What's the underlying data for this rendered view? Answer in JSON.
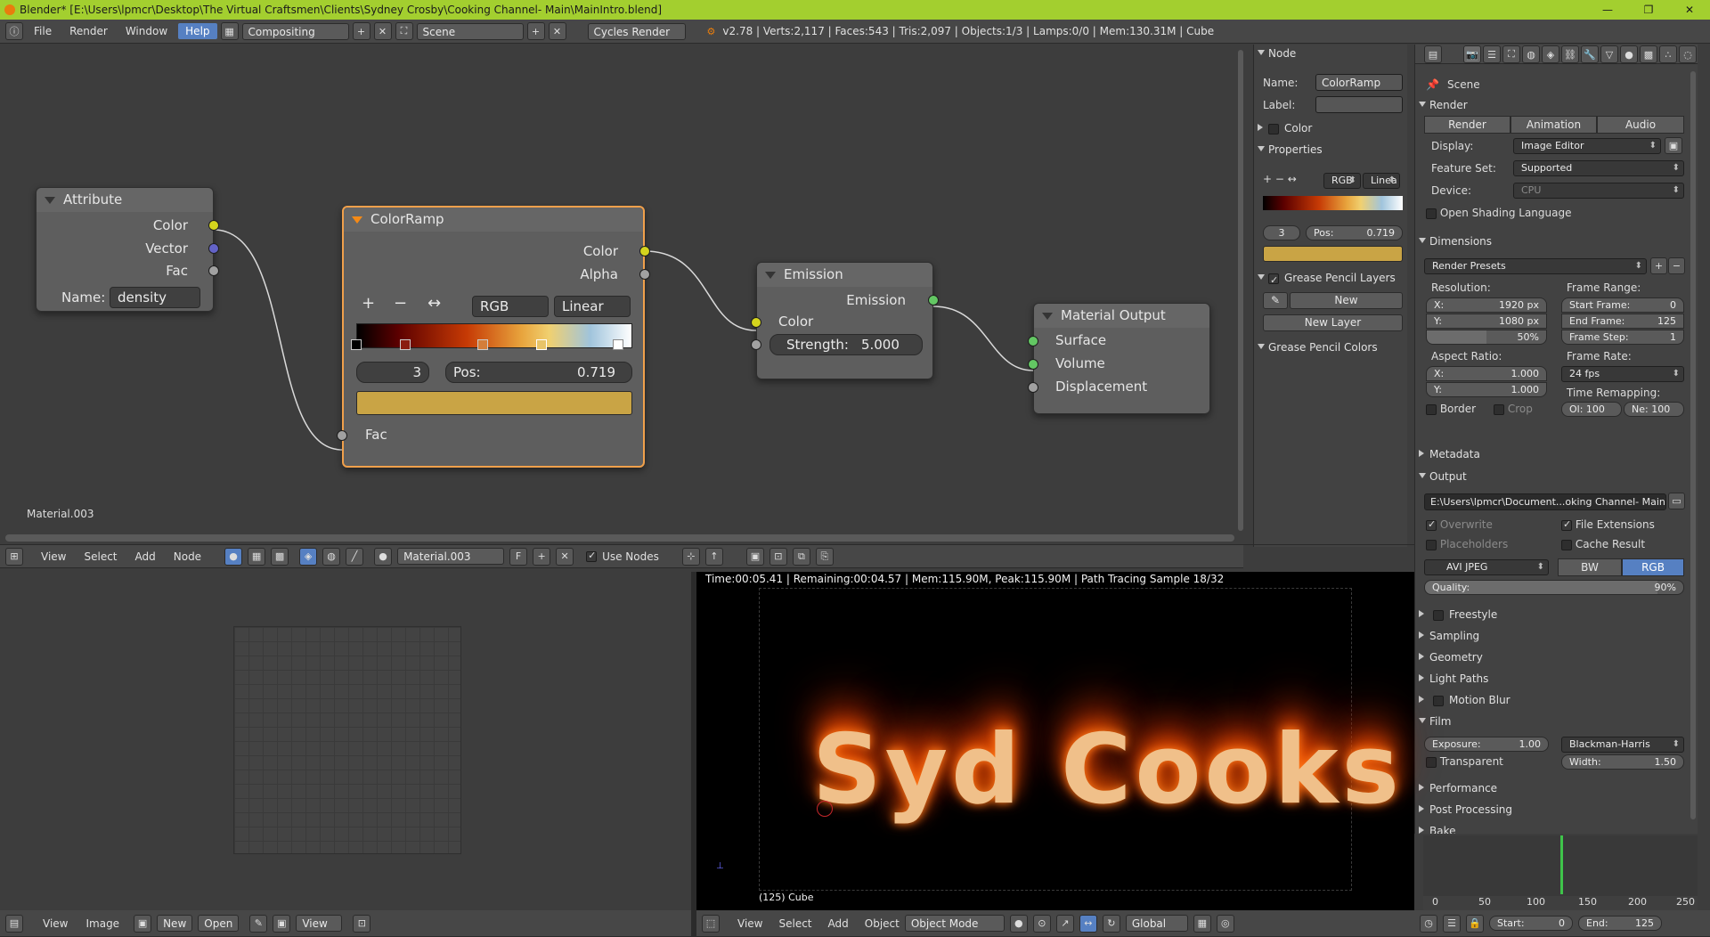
{
  "window": {
    "title": "Blender* [E:\\Users\\lpmcr\\Desktop\\The Virtual Craftsmen\\Clients\\Sydney Crosby\\Cooking Channel- Main\\MainIntro.blend]",
    "controls": [
      "—",
      "❐",
      "✕"
    ]
  },
  "menubar": {
    "items": [
      "File",
      "Render",
      "Window",
      "Help"
    ],
    "active": "Help",
    "screen": "Compositing",
    "scene": "Scene",
    "engine": "Cycles Render",
    "info": "v2.78 | Verts:2,117 | Faces:543 | Tris:2,097 | Objects:1/3 | Lamps:0/0 | Mem:130.31M | Cube"
  },
  "nodes": {
    "attribute": {
      "title": "Attribute",
      "outputs": [
        "Color",
        "Vector",
        "Fac"
      ],
      "name_label": "Name:",
      "name_value": "density"
    },
    "colorramp": {
      "title": "ColorRamp",
      "outputs": [
        "Color",
        "Alpha"
      ],
      "color_mode": "RGB",
      "interpolation": "Linear",
      "index": "3",
      "pos_label": "Pos:",
      "pos_value": "0.719",
      "input": "Fac",
      "active_color": "#c9a445"
    },
    "emission": {
      "title": "Emission",
      "output": "Emission",
      "input_color": "Color",
      "strength_label": "Strength:",
      "strength_value": "5.000"
    },
    "material_output": {
      "title": "Material Output",
      "inputs": [
        "Surface",
        "Volume",
        "Displacement"
      ]
    },
    "material_name": "Material.003"
  },
  "node_panel": {
    "section_node": "Node",
    "name_label": "Name:",
    "name_value": "ColorRamp",
    "label_label": "Label:",
    "color_section": "Color",
    "properties_section": "Properties",
    "rgb": "RGB",
    "interp": "Linea",
    "index": "3",
    "pos_label": "Pos:",
    "pos_value": "0.719",
    "gp_layers": "Grease Pencil Layers",
    "new": "New",
    "new_layer": "New Layer",
    "gp_colors": "Grease Pencil Colors"
  },
  "props": {
    "scene": "Scene",
    "render_section": "Render",
    "tabs": [
      "Render",
      "Animation",
      "Audio"
    ],
    "display_label": "Display:",
    "display_value": "Image Editor",
    "feature_label": "Feature Set:",
    "feature_value": "Supported",
    "device_label": "Device:",
    "device_value": "CPU",
    "osl": "Open Shading Language",
    "dimensions_section": "Dimensions",
    "render_presets": "Render Presets",
    "resolution_label": "Resolution:",
    "res_x_label": "X:",
    "res_x": "1920 px",
    "res_y_label": "Y:",
    "res_y": "1080 px",
    "res_pct": "50%",
    "frame_range_label": "Frame Range:",
    "start_frame_label": "Start Frame:",
    "start_frame": "0",
    "end_frame_label": "End Frame:",
    "end_frame": "125",
    "frame_step_label": "Frame Step:",
    "frame_step": "1",
    "aspect_label": "Aspect Ratio:",
    "asp_x_label": "X:",
    "asp_x": "1.000",
    "asp_y_label": "Y:",
    "asp_y": "1.000",
    "frame_rate_label": "Frame Rate:",
    "frame_rate": "24 fps",
    "time_remap_label": "Time Remapping:",
    "ol": "Ol: 100",
    "ne": "Ne: 100",
    "border": "Border",
    "crop": "Crop",
    "metadata": "Metadata",
    "output": "Output",
    "output_path": "E:\\Users\\lpmcr\\Document...oking Channel- Main\\yolo",
    "overwrite": "Overwrite",
    "file_ext": "File Extensions",
    "placeholders": "Placeholders",
    "cache_result": "Cache Result",
    "format": "AVI JPEG",
    "bw": "BW",
    "rgb": "RGB",
    "quality_label": "Quality:",
    "quality": "90%",
    "freestyle": "Freestyle",
    "sampling": "Sampling",
    "geometry": "Geometry",
    "light_paths": "Light Paths",
    "motion_blur": "Motion Blur",
    "film": "Film",
    "exposure_label": "Exposure:",
    "exposure": "1.00",
    "filter": "Blackman-Harris",
    "transparent": "Transparent",
    "width_label": "Width:",
    "width": "1.50",
    "performance": "Performance",
    "post_processing": "Post Processing",
    "bake": "Bake"
  },
  "node_header": {
    "view": "View",
    "select": "Select",
    "add": "Add",
    "node": "Node",
    "material": "Material.003",
    "fake": "F",
    "use_nodes": "Use Nodes"
  },
  "image_header": {
    "view": "View",
    "image": "Image",
    "new": "New",
    "open": "Open",
    "view2": "View"
  },
  "viewport": {
    "status": "Time:00:05.41 | Remaining:00:04.57 | Mem:115.90M, Peak:115.90M | Path Tracing Sample 18/32",
    "object": "(125) Cube",
    "render_text": "Syd Cooks",
    "view": "View",
    "select": "Select",
    "add": "Add",
    "object_menu": "Object",
    "mode": "Object Mode",
    "orientation": "Global"
  },
  "timeline": {
    "ticks": [
      "0",
      "50",
      "100",
      "150",
      "200",
      "250"
    ],
    "start_label": "Start:",
    "start": "0",
    "end_label": "End:",
    "end": "125"
  }
}
